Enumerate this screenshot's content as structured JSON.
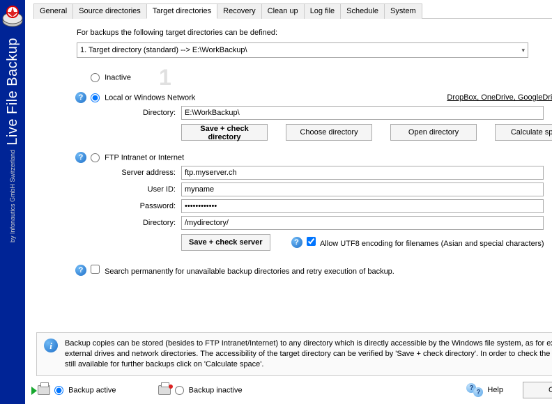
{
  "sidebar": {
    "app_name": "Live File Backup",
    "vendor": "by Infonautics GmbH Switzerland"
  },
  "tabs": [
    "General",
    "Source directories",
    "Target directories",
    "Recovery",
    "Clean up",
    "Log file",
    "Schedule",
    "System"
  ],
  "active_tab": 2,
  "intro": "For backups the following target directories can be defined:",
  "target_select": "1. Target directory (standard) --> E:\\WorkBackup\\",
  "radios": {
    "inactive_label": "Inactive",
    "local_label": "Local or Windows Network",
    "ftp_label": "FTP Intranet or Internet"
  },
  "cloud_link": "DropBox, OneDrive, GoogleDrive",
  "local": {
    "dir_label": "Directory:",
    "dir_value": "E:\\WorkBackup\\",
    "btn_save": "Save + check directory",
    "btn_choose": "Choose directory",
    "btn_open": "Open directory",
    "btn_calc": "Calculate space"
  },
  "ftp": {
    "server_label": "Server address:",
    "server_value": "ftp.myserver.ch",
    "user_label": "User ID:",
    "user_value": "myname",
    "pass_label": "Password:",
    "pass_value": "************",
    "dir_label": "Directory:",
    "dir_value": "/mydirectory/",
    "btn_save": "Save + check server",
    "utf8_label": "Allow UTF8 encoding for filenames (Asian and special characters)"
  },
  "search_perm_label": "Search permanently for unavailable backup directories and retry execution of backup.",
  "info_text": "Backup copies can be stored (besides to FTP Intranet/Internet) to any directory which is directly accessible by the Windows file system, as for example external drives and network directories. The accessibility of the target directory can be verified by 'Save + check directory'. In order to check the space still available for further backups click on 'Calculate space'.",
  "footer": {
    "active_label": "Backup active",
    "inactive_label": "Backup inactive",
    "help_label": "Help",
    "ok_label": "OK"
  },
  "bignum": "1"
}
